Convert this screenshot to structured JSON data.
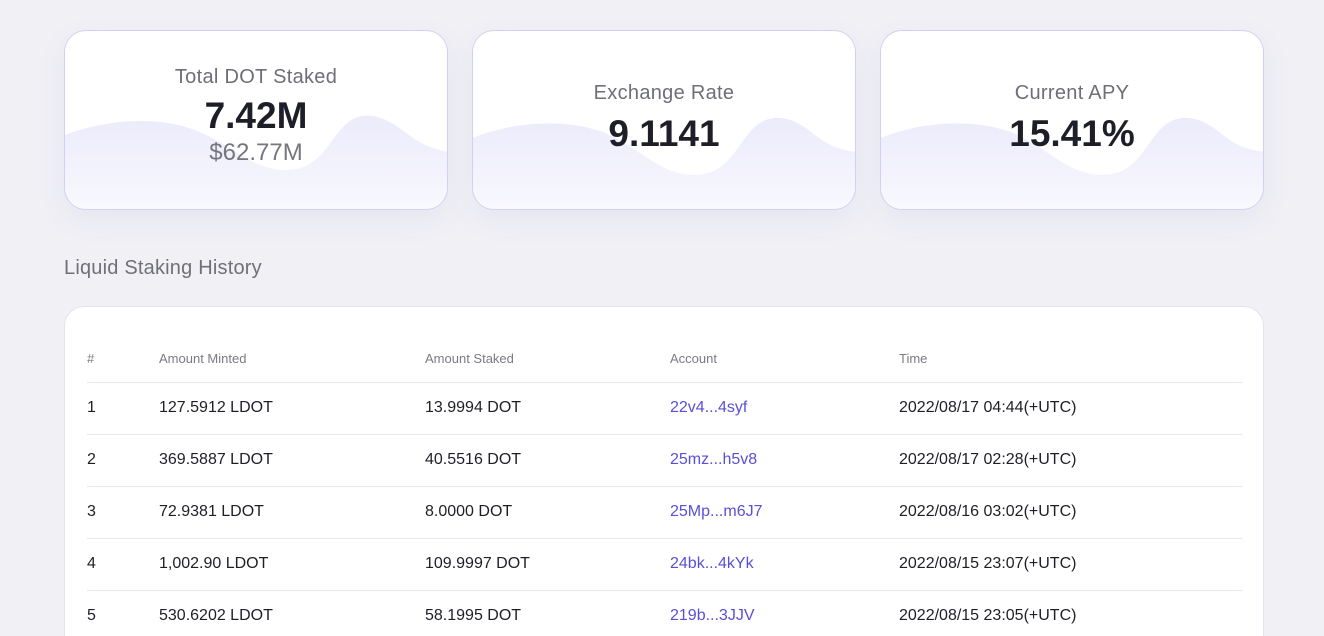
{
  "stats": {
    "total_staked": {
      "label": "Total DOT Staked",
      "value": "7.42M",
      "sub": "$62.77M"
    },
    "exchange_rate": {
      "label": "Exchange Rate",
      "value": "9.1141"
    },
    "current_apy": {
      "label": "Current APY",
      "value": "15.41%"
    }
  },
  "history": {
    "title": "Liquid Staking History",
    "columns": [
      "#",
      "Amount Minted",
      "Amount Staked",
      "Account",
      "Time"
    ],
    "rows": [
      {
        "n": "1",
        "minted": "127.5912 LDOT",
        "staked": "13.9994 DOT",
        "account": "22v4...4syf",
        "time": "2022/08/17 04:44(+UTC)"
      },
      {
        "n": "2",
        "minted": "369.5887 LDOT",
        "staked": "40.5516 DOT",
        "account": "25mz...h5v8",
        "time": "2022/08/17 02:28(+UTC)"
      },
      {
        "n": "3",
        "minted": "72.9381 LDOT",
        "staked": "8.0000 DOT",
        "account": "25Mp...m6J7",
        "time": "2022/08/16 03:02(+UTC)"
      },
      {
        "n": "4",
        "minted": "1,002.90 LDOT",
        "staked": "109.9997 DOT",
        "account": "24bk...4kYk",
        "time": "2022/08/15 23:07(+UTC)"
      },
      {
        "n": "5",
        "minted": "530.6202 LDOT",
        "staked": "58.1995 DOT",
        "account": "219b...3JJV",
        "time": "2022/08/15 23:05(+UTC)"
      }
    ]
  },
  "colors": {
    "accent": "#5a4fd6",
    "card_border": "#d4cff2",
    "wave": "#efedfc",
    "background": "#f0f0f5"
  }
}
